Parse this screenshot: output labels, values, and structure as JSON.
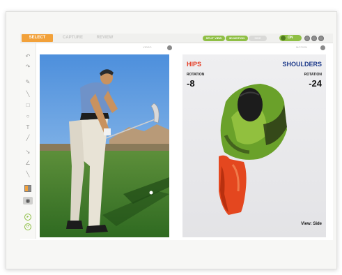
{
  "app": {
    "tabs": [
      {
        "label": "SELECT",
        "active": true
      },
      {
        "label": "CAPTURE",
        "active": false
      },
      {
        "label": "REVIEW",
        "active": false
      }
    ],
    "view_buttons": [
      {
        "label": "SPLIT VIEW",
        "on": true
      },
      {
        "label": "3D MOTION",
        "on": true
      },
      {
        "label": "SIDE",
        "on": false
      }
    ],
    "toggle": {
      "label": "ON"
    },
    "right_icons": [
      "gear-icon",
      "help-icon",
      "close-icon"
    ],
    "tools": [
      "undo-icon",
      "redo-icon",
      "pencil-icon",
      "line-icon",
      "rectangle-icon",
      "circle-icon",
      "text-icon",
      "brush-icon",
      "arrow-icon",
      "angle-icon",
      "ruler-icon",
      "grid-icon",
      "eye-icon",
      "play-icon",
      "loop-icon"
    ]
  },
  "video_panel": {
    "header": "VIDEO"
  },
  "motion_panel": {
    "header": "MOTION",
    "hips": {
      "title": "HIPS",
      "label": "ROTATION",
      "value": "-8"
    },
    "shoulders": {
      "title": "SHOULDERS",
      "label": "ROTATION",
      "value": "-24"
    },
    "view_label": "View: Side",
    "colors": {
      "hips": "#e43a22",
      "shoulders": "#1d3a8a"
    }
  }
}
